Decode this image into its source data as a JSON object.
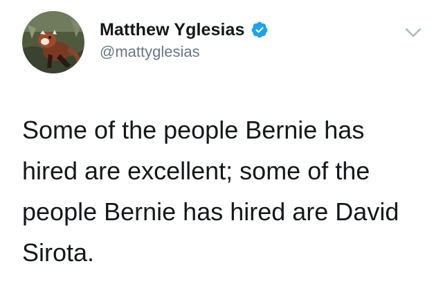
{
  "tweet": {
    "author": {
      "display_name": "Matthew Yglesias",
      "handle": "@mattyglesias",
      "verified": true,
      "avatar_icon": "red-panda-avatar"
    },
    "menu_icon": "chevron-down-icon",
    "text_lines": [
      "Some of the people Bernie has",
      "hired are excellent; some of the",
      "people Bernie has hired are David",
      "Sirota."
    ]
  },
  "colors": {
    "name": "#14171a",
    "handle": "#657786",
    "verified_badge": "#1da1f2",
    "caret": "#aab8c2"
  }
}
